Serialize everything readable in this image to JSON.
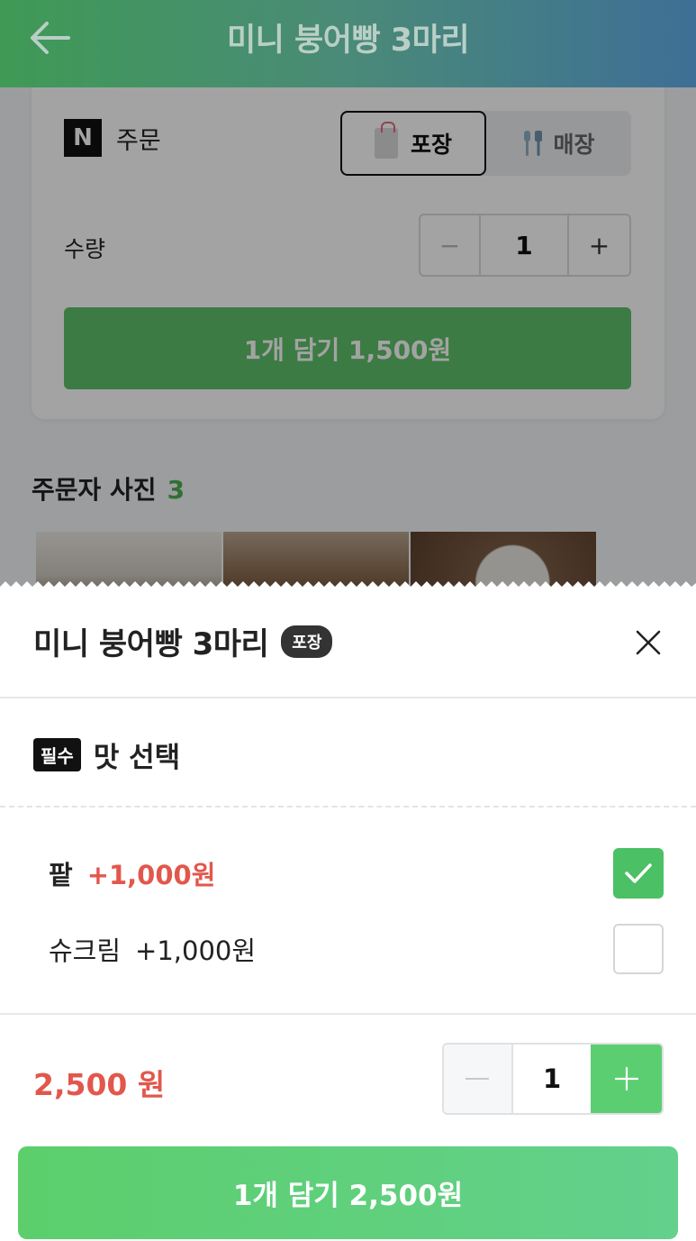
{
  "header": {
    "title": "미니 붕어빵 3마리"
  },
  "order_card": {
    "order_label": "주문",
    "n_logo": "N",
    "toggle": {
      "takeout": "포장",
      "dine_in": "매장"
    },
    "quantity_label": "수량",
    "quantity_minus": "−",
    "quantity_value": "1",
    "quantity_plus": "+",
    "add_button": "1개 담기 1,500원"
  },
  "photos": {
    "title": "주문자 사진",
    "count": "3"
  },
  "sheet": {
    "title": "미니 붕어빵 3마리",
    "badge": "포장",
    "section": {
      "required_badge": "필수",
      "title": "맛 선택"
    },
    "options": [
      {
        "name": "팥",
        "price": "+1,000원",
        "checked": true
      },
      {
        "name": "슈크림",
        "price": "+1,000원",
        "checked": false
      }
    ],
    "total_price": "2,500 원",
    "quantity": "1",
    "cta": "1개 담기 2,500원"
  },
  "colors": {
    "accent_green": "#4cc064",
    "price_red": "#e2574c"
  }
}
